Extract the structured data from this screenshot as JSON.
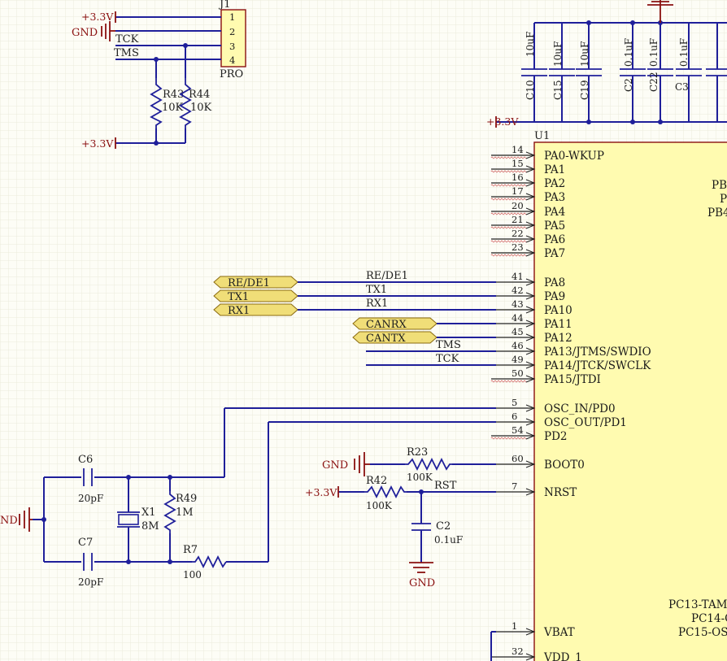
{
  "power": {
    "v33": "+3.3V",
    "gnd": "GND",
    "gnd_left": "ND"
  },
  "j1": {
    "ref": "J1",
    "pins": [
      "1",
      "2",
      "3",
      "4"
    ],
    "value": "PRO",
    "net_tck": "TCK",
    "net_tms": "TMS"
  },
  "pullups": [
    {
      "ref": "R43",
      "value": "10K"
    },
    {
      "ref": "R44",
      "value": "10K"
    }
  ],
  "caps_top": [
    {
      "ref": "C10",
      "value": "10uF"
    },
    {
      "ref": "C15",
      "value": "10uF"
    },
    {
      "ref": "C19",
      "value": "10uF"
    },
    {
      "ref": "C2",
      "value": "0.1uF"
    },
    {
      "ref": "C22",
      "value": "0.1uF"
    },
    {
      "ref": "C3",
      "value": "0.1uF"
    }
  ],
  "u1": {
    "ref": "U1",
    "pins": [
      {
        "num": "14",
        "name": "PA0-WKUP"
      },
      {
        "num": "15",
        "name": "PA1"
      },
      {
        "num": "16",
        "name": "PA2"
      },
      {
        "num": "17",
        "name": "PA3"
      },
      {
        "num": "20",
        "name": "PA4"
      },
      {
        "num": "21",
        "name": "PA5"
      },
      {
        "num": "22",
        "name": "PA6"
      },
      {
        "num": "23",
        "name": "PA7"
      },
      {
        "num": "41",
        "name": "PA8"
      },
      {
        "num": "42",
        "name": "PA9"
      },
      {
        "num": "43",
        "name": "PA10"
      },
      {
        "num": "44",
        "name": "PA11"
      },
      {
        "num": "45",
        "name": "PA12"
      },
      {
        "num": "46",
        "name": "PA13/JTMS/SWDIO"
      },
      {
        "num": "49",
        "name": "PA14/JTCK/SWCLK"
      },
      {
        "num": "50",
        "name": "PA15/JTDI"
      },
      {
        "num": "5",
        "name": "OSC_IN/PD0"
      },
      {
        "num": "6",
        "name": "OSC_OUT/PD1"
      },
      {
        "num": "54",
        "name": "PD2"
      },
      {
        "num": "60",
        "name": "BOOT0"
      },
      {
        "num": "7",
        "name": "NRST"
      },
      {
        "num": "1",
        "name": "VBAT"
      },
      {
        "num": "32",
        "name": "VDD_1"
      }
    ],
    "right_pins": [
      "PB",
      "P",
      "PB4",
      "PC13-TAMP",
      "PC14-O",
      "PC15-OS"
    ]
  },
  "ports": [
    "RE/DE1",
    "TX1",
    "RX1",
    "CANRX",
    "CANTX"
  ],
  "nets": {
    "rede": "RE/DE1",
    "tx1": "TX1",
    "rx1": "RX1",
    "tms": "TMS",
    "tck": "TCK",
    "rst": "RST"
  },
  "osc": {
    "c6": {
      "ref": "C6",
      "value": "20pF"
    },
    "c7": {
      "ref": "C7",
      "value": "20pF"
    },
    "x1": {
      "ref": "X1",
      "value": "8M"
    },
    "r49": {
      "ref": "R49",
      "value": "1M"
    },
    "r7": {
      "ref": "R7",
      "value": "100"
    }
  },
  "boot": {
    "r23": {
      "ref": "R23",
      "value": "100K"
    },
    "r42": {
      "ref": "R42",
      "value": "100K"
    },
    "c2": {
      "ref": "C2",
      "value": "0.1uF"
    }
  }
}
